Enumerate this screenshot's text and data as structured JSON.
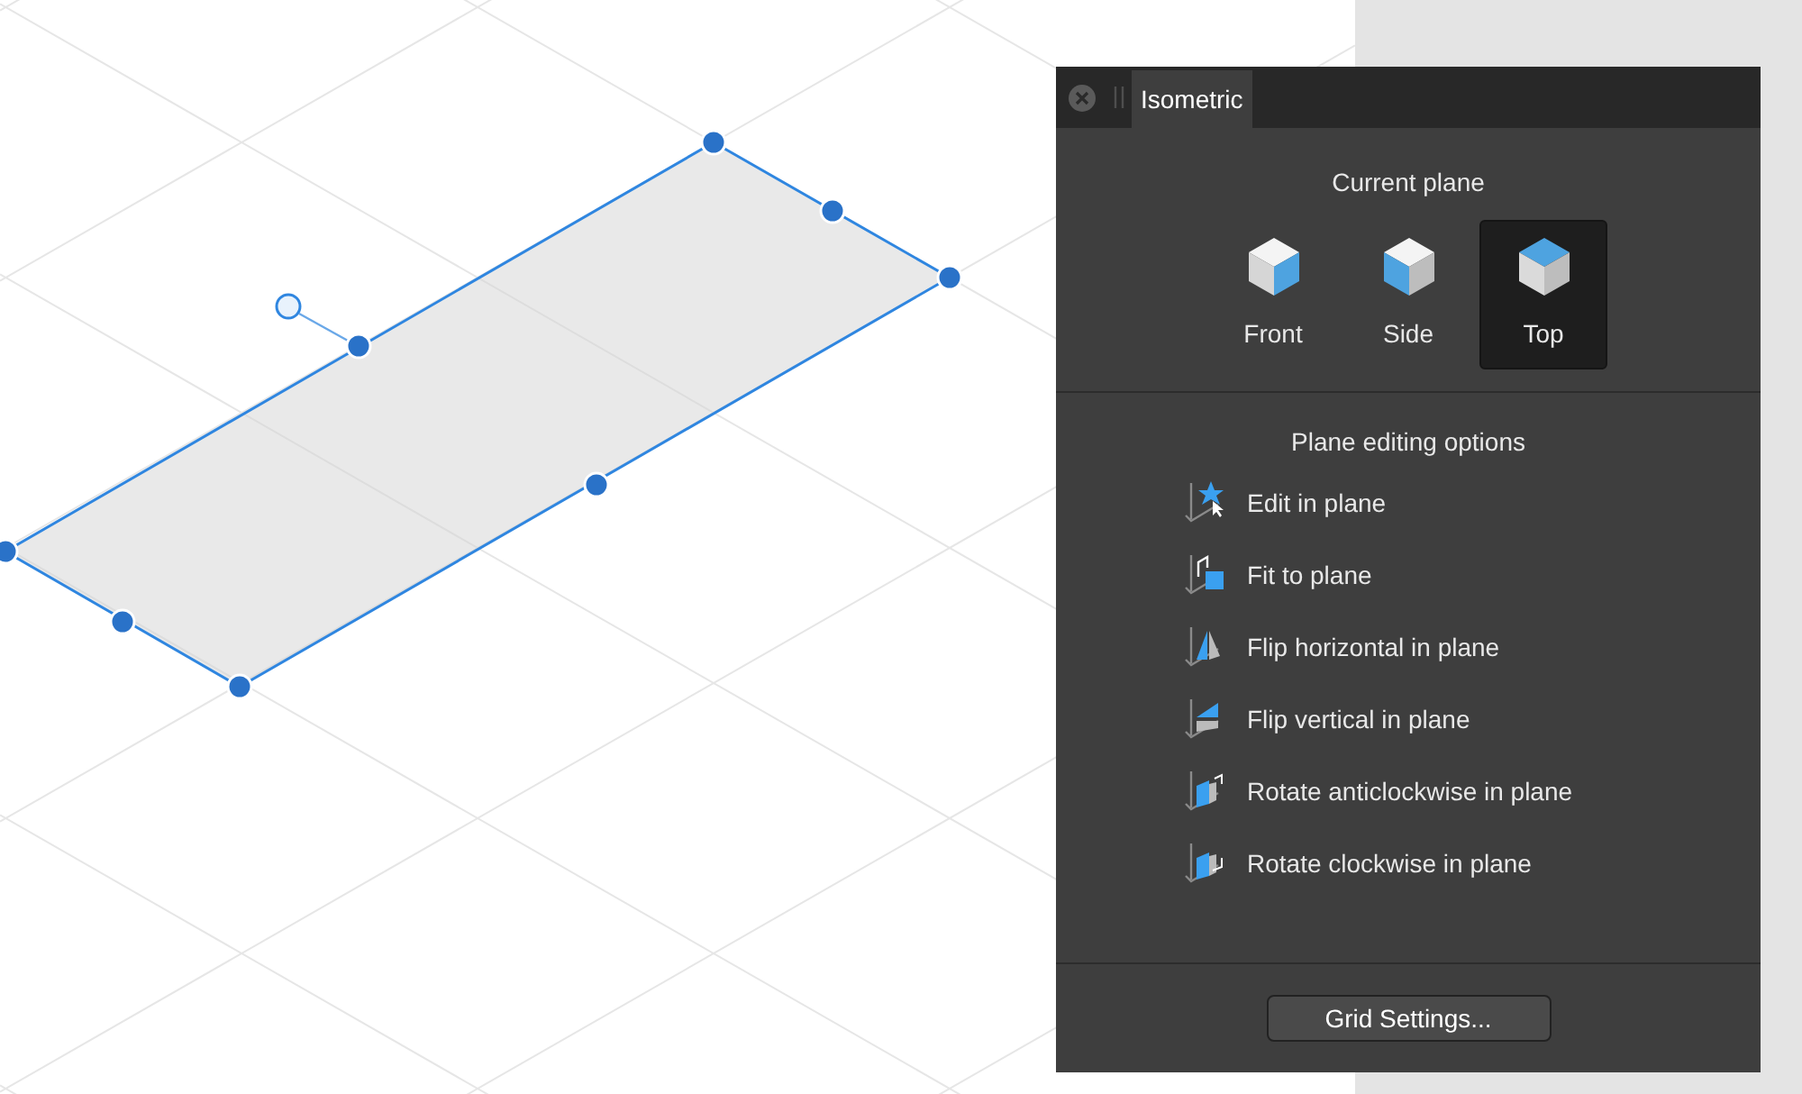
{
  "panel": {
    "tab": "Isometric",
    "current_plane_heading": "Current plane",
    "planes": [
      {
        "label": "Front",
        "selected": false
      },
      {
        "label": "Side",
        "selected": false
      },
      {
        "label": "Top",
        "selected": true
      }
    ],
    "editing_heading": "Plane editing options",
    "options": [
      "Edit in plane",
      "Fit to plane",
      "Flip horizontal in plane",
      "Flip vertical in plane",
      "Rotate anticlockwise in plane",
      "Rotate clockwise in plane"
    ],
    "grid_button": "Grid Settings..."
  }
}
